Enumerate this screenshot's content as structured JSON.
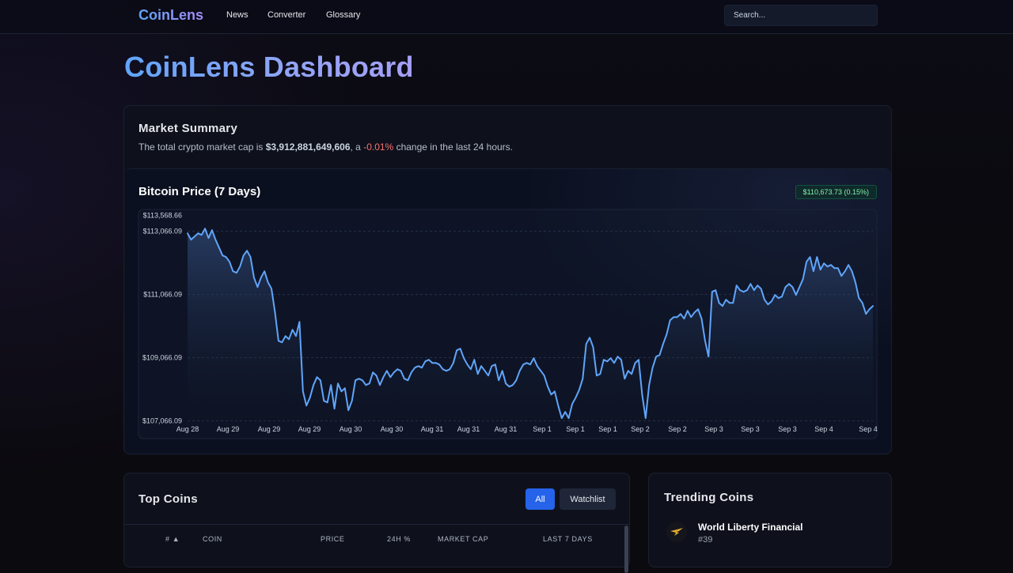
{
  "nav": {
    "brand": "CoinLens",
    "links": [
      "News",
      "Converter",
      "Glossary"
    ],
    "search_placeholder": "Search..."
  },
  "page_title": "CoinLens Dashboard",
  "summary": {
    "title": "Market Summary",
    "text_prefix": "The total crypto market cap is ",
    "market_cap": "$3,912,881,649,606",
    "text_mid": ", a ",
    "change": "-0.01%",
    "text_suffix": " change in the last 24 hours."
  },
  "chart": {
    "title": "Bitcoin Price (7 Days)",
    "badge": "$110,673.73 (0.15%)",
    "line_color": "#60a5fa",
    "badge_color": "#86efac"
  },
  "chart_data": {
    "type": "area",
    "title": "Bitcoin Price (7 Days)",
    "ylim": [
      107066.09,
      113568.66
    ],
    "y_tick_labels": [
      "$113,568.66",
      "$113,066.09",
      "$111,066.09",
      "$109,066.09",
      "$107,066.09"
    ],
    "y_tick_values": [
      113568.66,
      113066.09,
      111066.09,
      109066.09,
      107066.09
    ],
    "x_tick_labels": [
      "Aug 28",
      "Aug 29",
      "Aug 29",
      "Aug 29",
      "Aug 30",
      "Aug 30",
      "Aug 31",
      "Aug 31",
      "Aug 31",
      "Sep 1",
      "Sep 1",
      "Sep 1",
      "Sep 2",
      "Sep 2",
      "Sep 3",
      "Sep 3",
      "Sep 3",
      "Sep 4",
      "Sep 4"
    ],
    "grid": true,
    "values": [
      113000,
      112800,
      112900,
      113000,
      112950,
      113150,
      112850,
      113100,
      112800,
      112550,
      112300,
      112250,
      112100,
      111800,
      111750,
      111950,
      112300,
      112450,
      112250,
      111600,
      111300,
      111600,
      111800,
      111450,
      111250,
      110500,
      109600,
      109550,
      109750,
      109650,
      109950,
      109750,
      110200,
      108000,
      107550,
      107800,
      108200,
      108450,
      108350,
      107700,
      107650,
      108200,
      107450,
      108250,
      108000,
      108100,
      107400,
      107700,
      108350,
      108400,
      108350,
      108200,
      108250,
      108600,
      108500,
      108200,
      108450,
      108650,
      108450,
      108600,
      108700,
      108650,
      108400,
      108350,
      108600,
      108750,
      108800,
      108750,
      108950,
      109000,
      108900,
      108900,
      108850,
      108700,
      108650,
      108700,
      108900,
      109300,
      109350,
      109050,
      108850,
      108700,
      109000,
      108550,
      108800,
      108650,
      108500,
      108800,
      108850,
      108350,
      108650,
      108250,
      108150,
      108200,
      108350,
      108650,
      108850,
      108900,
      108850,
      109050,
      108800,
      108650,
      108500,
      108150,
      107900,
      108000,
      107550,
      107150,
      107350,
      107150,
      107600,
      107800,
      108050,
      108400,
      109500,
      109700,
      109400,
      108500,
      108550,
      109000,
      108950,
      109050,
      108900,
      109100,
      109000,
      108400,
      108650,
      108550,
      108900,
      109000,
      107900,
      107150,
      108200,
      108750,
      109100,
      109150,
      109500,
      109800,
      110250,
      110350,
      110350,
      110450,
      110300,
      110550,
      110350,
      110500,
      110600,
      110300,
      109600,
      109100,
      111150,
      111200,
      110800,
      110700,
      110900,
      110800,
      110800,
      111350,
      111200,
      111150,
      111200,
      111400,
      111200,
      111350,
      111250,
      110900,
      110750,
      110850,
      111050,
      110950,
      111000,
      111300,
      111400,
      111300,
      111050,
      111300,
      111550,
      112100,
      112250,
      111800,
      112250,
      111850,
      112050,
      111950,
      112000,
      111900,
      111900,
      111650,
      111800,
      112000,
      111800,
      111450,
      110950,
      110800,
      110450,
      110600,
      110700
    ]
  },
  "top_coins": {
    "title": "Top Coins",
    "buttons": {
      "all": "All",
      "watchlist": "Watchlist"
    },
    "headers": [
      "# ▲",
      "COIN",
      "PRICE",
      "24H %",
      "MARKET CAP",
      "LAST 7 DAYS"
    ]
  },
  "trending": {
    "title": "Trending Coins",
    "items": [
      {
        "name": "World Liberty Financial",
        "rank": "#39",
        "icon": "wing-icon"
      }
    ]
  }
}
